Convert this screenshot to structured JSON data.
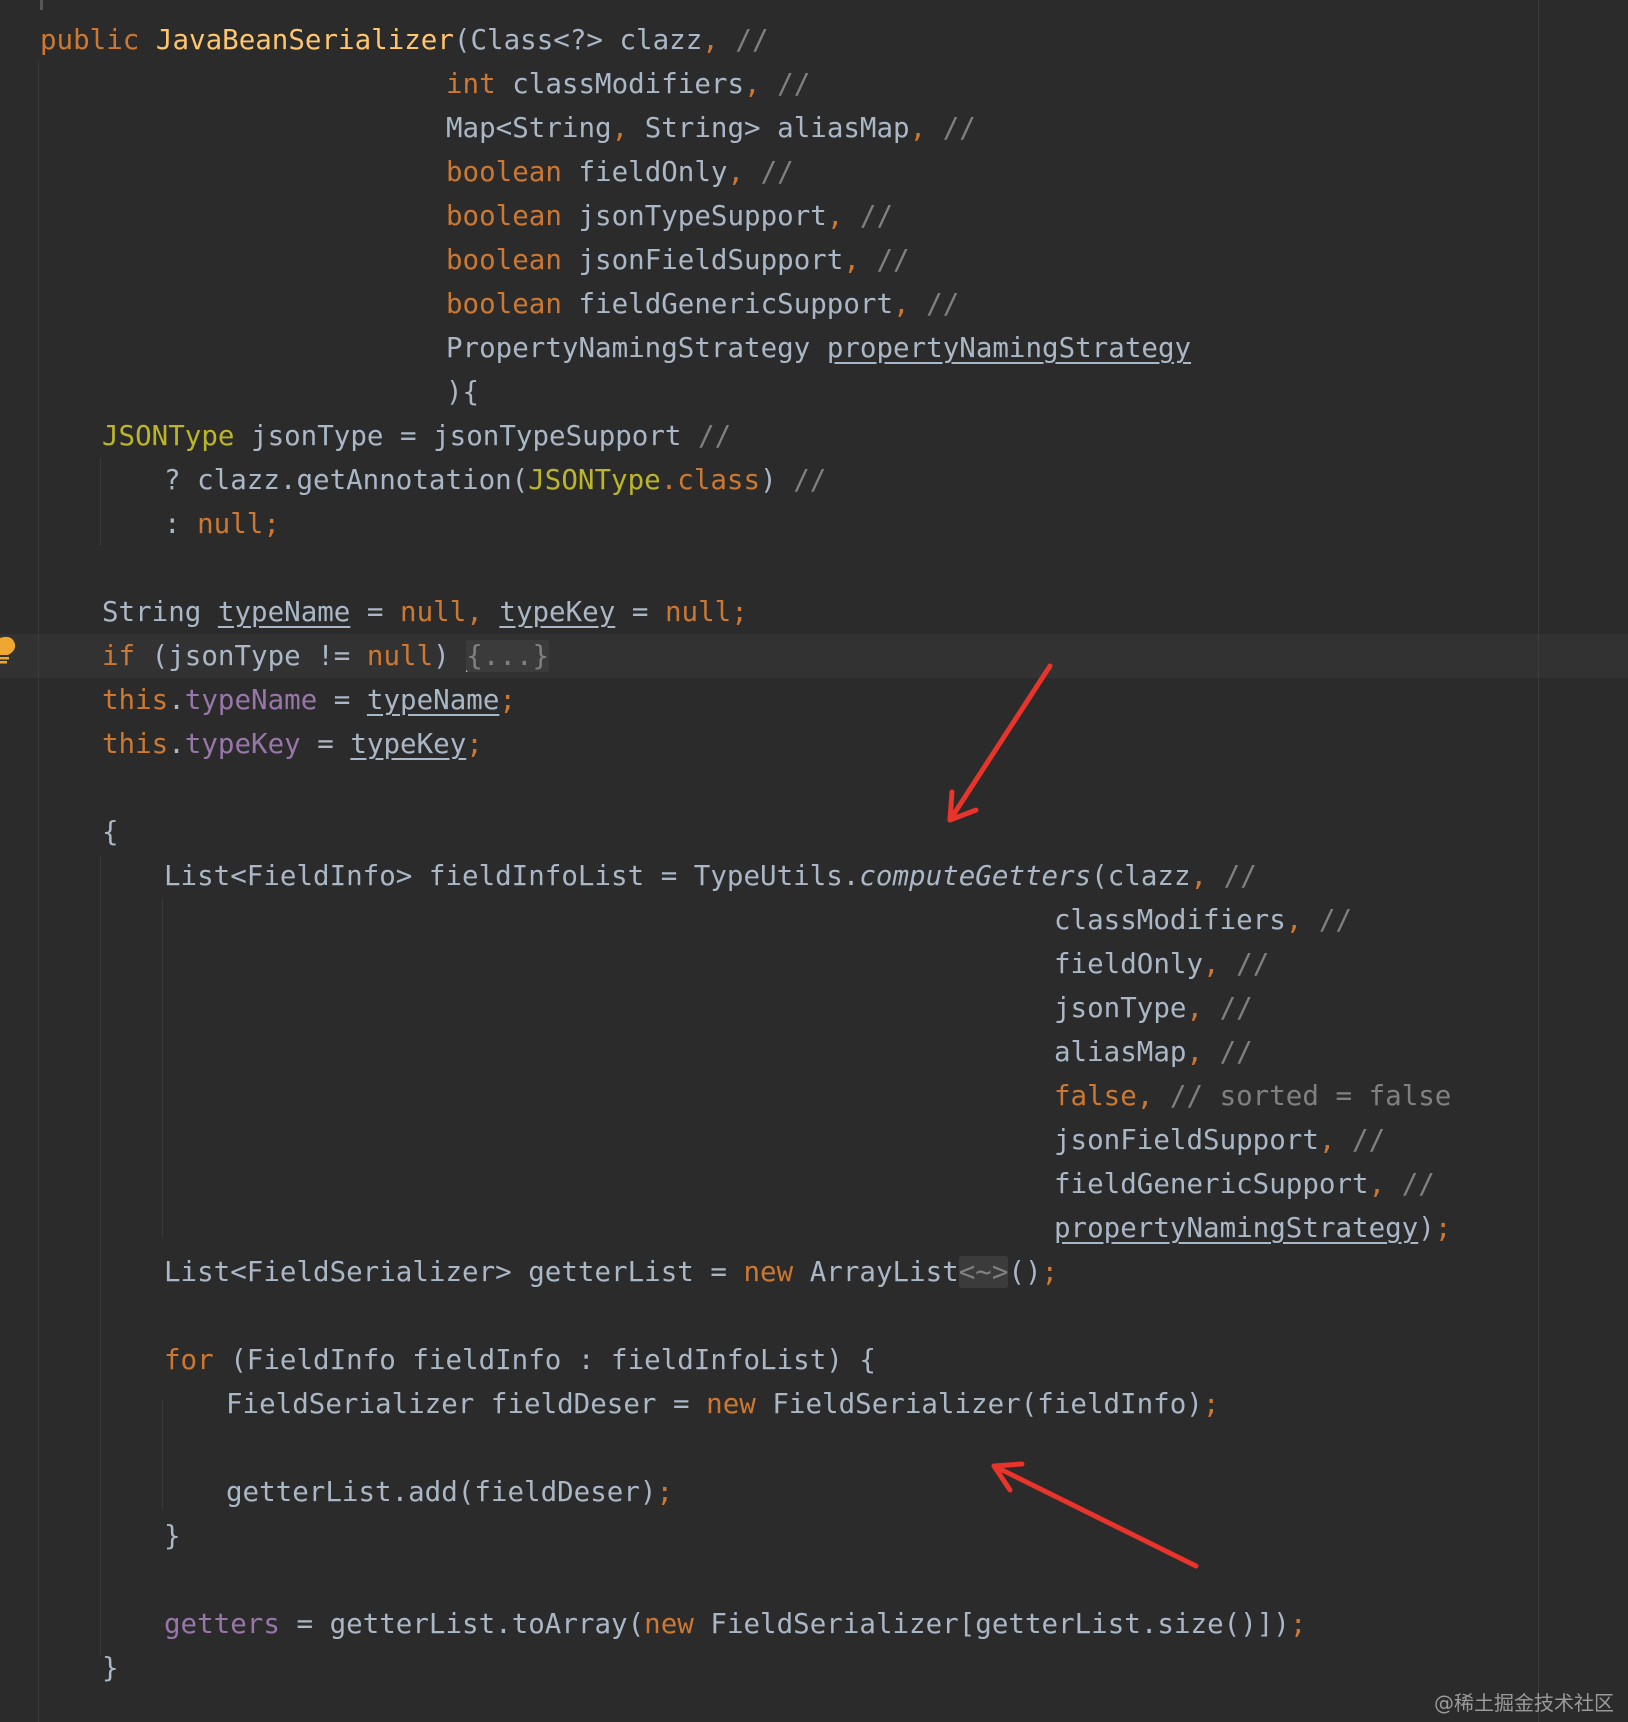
{
  "code": {
    "l1": {
      "public": "public ",
      "name": "JavaBeanSerializer",
      "open": "(Class<?> clazz",
      "comma": ",",
      "cm": " //"
    },
    "l2": {
      "kw": "int",
      "rest": " classModifiers",
      "comma": ",",
      "cm": " //"
    },
    "l3": {
      "rest": "Map<String",
      "comma1": ",",
      "rest2": " String> aliasMap",
      "comma": ",",
      "cm": " //"
    },
    "l4": {
      "kw": "boolean",
      "rest": " fieldOnly",
      "comma": ",",
      "cm": " //"
    },
    "l5": {
      "kw": "boolean",
      "rest": " jsonTypeSupport",
      "comma": ",",
      "cm": " //"
    },
    "l6": {
      "kw": "boolean",
      "rest": " jsonFieldSupport",
      "comma": ",",
      "cm": " //"
    },
    "l7": {
      "kw": "boolean",
      "rest": " fieldGenericSupport",
      "comma": ",",
      "cm": " //"
    },
    "l8": {
      "rest": "PropertyNamingStrategy ",
      "param": "propertyNamingStrategy"
    },
    "l9": {
      "rest": "){"
    },
    "l10": {
      "ann": "JSONType",
      "rest": " jsonType = jsonTypeSupport ",
      "cm": "//"
    },
    "l11": {
      "rest": "? clazz.getAnnotation(",
      "ann": "JSONType",
      "dot": ".",
      "kw": "class",
      "close": ") ",
      "cm": "//"
    },
    "l12": {
      "rest": ": ",
      "kw": "null;"
    },
    "l13": {
      "rest": "String ",
      "v1": "typeName",
      "eq1": " = ",
      "null1": "null",
      "comma": ", ",
      "v2": "typeKey",
      "eq2": " = ",
      "null2": "null;"
    },
    "l14": {
      "kw": "if",
      "rest": " (jsonType != ",
      "null": "null",
      "close": ") ",
      "fold": "{...}"
    },
    "l15": {
      "this": "this",
      "dot": ".",
      "fld": "typeName",
      "eq": " = ",
      "v": "typeName",
      "semi": ";"
    },
    "l16": {
      "this": "this",
      "dot": ".",
      "fld": "typeKey",
      "eq": " = ",
      "v": "typeKey",
      "semi": ";"
    },
    "l17": {
      "rest": "{"
    },
    "l18": {
      "rest": "List<FieldInfo> fieldInfoList = TypeUtils.",
      "method": "computeGetters",
      "open": "(clazz",
      "comma": ",",
      "cm": " //"
    },
    "l19": {
      "rest": "classModifiers",
      "comma": ",",
      "cm": " //"
    },
    "l20": {
      "rest": "fieldOnly",
      "comma": ",",
      "cm": " //"
    },
    "l21": {
      "rest": "jsonType",
      "comma": ",",
      "cm": " //"
    },
    "l22": {
      "rest": "aliasMap",
      "comma": ",",
      "cm": " //"
    },
    "l23": {
      "kw": "false,",
      "cm": " // sorted = false"
    },
    "l24": {
      "rest": "jsonFieldSupport",
      "comma": ",",
      "cm": " //"
    },
    "l25": {
      "rest": "fieldGenericSupport",
      "comma": ",",
      "cm": " //"
    },
    "l26": {
      "param": "propertyNamingStrategy",
      "close": ")",
      "semi": ";"
    },
    "l27": {
      "rest": "List<FieldSerializer> getterList = ",
      "kw": "new",
      "rest2": " ArrayList",
      "hint": "<~>",
      "close": "()",
      "semi": ";"
    },
    "l28": {
      "kw": "for",
      "rest": " (FieldInfo fieldInfo : fieldInfoList) {"
    },
    "l29": {
      "rest": "FieldSerializer fieldDeser = ",
      "kw": "new",
      "rest2": " FieldSerializer(fieldInfo)",
      "semi": ";"
    },
    "l30": {
      "rest": "getterList.add(fieldDeser)",
      "semi": ";"
    },
    "l31": {
      "rest": "}"
    },
    "l32": {
      "fld": "getters",
      "rest": " = getterList.toArray(",
      "kw": "new",
      "rest2": " FieldSerializer[getterList.size()])",
      "semi": ";"
    },
    "l33": {
      "rest": "}"
    }
  },
  "watermark": "@稀土掘金技术社区",
  "colors": {
    "background": "#2b2b2b",
    "text": "#a9b7c6",
    "keyword": "#cc7832",
    "function": "#ffc66d",
    "comment": "#808080",
    "annotation": "#bbb529",
    "field": "#9876aa",
    "arrow": "#e8342a"
  },
  "icons": {
    "gutter": "lightbulb-icon",
    "annotations": "red-arrow-icon"
  }
}
